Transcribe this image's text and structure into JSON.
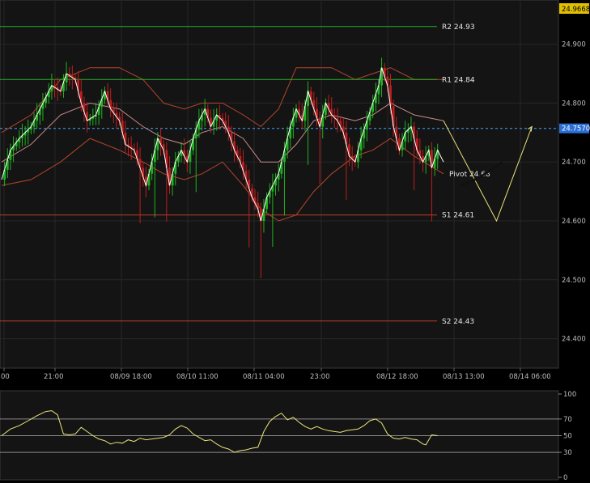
{
  "chart_data": [
    {
      "type": "candlestick",
      "ylim": [
        24.35,
        24.975
      ],
      "y_ticks": [
        24.4,
        24.5,
        24.6,
        24.7,
        24.8,
        24.9
      ],
      "y_tick_labels": [
        "24.400",
        "24.500",
        "24.600",
        "24.700",
        "24.800",
        "24.900"
      ],
      "x_tick_labels": [
        "00",
        "21:00",
        "08/09 18:00",
        "08/10 11:00",
        "08/11 04:00",
        "23:00",
        "08/12 18:00",
        "08/13 13:00",
        "08/14 06:00"
      ],
      "top_price_tag": "24.9668",
      "current_price": 24.757,
      "current_price_label": "24.7570",
      "levels": [
        {
          "name": "R2",
          "value": 24.93,
          "label": "R2 24.93",
          "color": "#27b12a"
        },
        {
          "name": "R1",
          "value": 24.84,
          "label": "R1 24.84",
          "color": "#27b12a"
        },
        {
          "name": "Pivot",
          "value": 24.68,
          "label": "Pivot 24.68",
          "color": "#cfcfcf"
        },
        {
          "name": "S1",
          "value": 24.61,
          "label": "S1 24.61",
          "color": "#c0392b"
        },
        {
          "name": "S2",
          "value": 24.43,
          "label": "S2 24.43",
          "color": "#c0392b"
        }
      ],
      "close_path": [
        [
          0,
          24.67
        ],
        [
          3,
          24.72
        ],
        [
          6,
          24.74
        ],
        [
          10,
          24.76
        ],
        [
          14,
          24.8
        ],
        [
          17,
          24.83
        ],
        [
          20,
          24.82
        ],
        [
          22,
          24.85
        ],
        [
          25,
          24.84
        ],
        [
          27,
          24.8
        ],
        [
          29,
          24.77
        ],
        [
          32,
          24.78
        ],
        [
          35,
          24.82
        ],
        [
          37,
          24.79
        ],
        [
          40,
          24.77
        ],
        [
          42,
          24.73
        ],
        [
          45,
          24.72
        ],
        [
          47,
          24.69
        ],
        [
          49,
          24.66
        ],
        [
          51,
          24.7
        ],
        [
          53,
          24.74
        ],
        [
          55,
          24.72
        ],
        [
          57,
          24.66
        ],
        [
          59,
          24.7
        ],
        [
          61,
          24.72
        ],
        [
          63,
          24.7
        ],
        [
          65,
          24.74
        ],
        [
          67,
          24.77
        ],
        [
          69,
          24.79
        ],
        [
          71,
          24.76
        ],
        [
          73,
          24.78
        ],
        [
          75,
          24.77
        ],
        [
          77,
          24.75
        ],
        [
          79,
          24.72
        ],
        [
          81,
          24.7
        ],
        [
          83,
          24.67
        ],
        [
          85,
          24.64
        ],
        [
          87,
          24.62
        ],
        [
          88,
          24.6
        ],
        [
          90,
          24.64
        ],
        [
          92,
          24.66
        ],
        [
          94,
          24.68
        ],
        [
          96,
          24.72
        ],
        [
          98,
          24.76
        ],
        [
          100,
          24.79
        ],
        [
          102,
          24.77
        ],
        [
          104,
          24.82
        ],
        [
          106,
          24.79
        ],
        [
          108,
          24.76
        ],
        [
          110,
          24.8
        ],
        [
          112,
          24.78
        ],
        [
          114,
          24.77
        ],
        [
          116,
          24.75
        ],
        [
          118,
          24.71
        ],
        [
          120,
          24.7
        ],
        [
          122,
          24.74
        ],
        [
          124,
          24.77
        ],
        [
          126,
          24.8
        ],
        [
          128,
          24.83
        ],
        [
          129,
          24.86
        ],
        [
          131,
          24.83
        ],
        [
          133,
          24.76
        ],
        [
          135,
          24.72
        ],
        [
          137,
          24.75
        ],
        [
          139,
          24.76
        ],
        [
          141,
          24.72
        ],
        [
          143,
          24.7
        ],
        [
          145,
          24.72
        ],
        [
          146,
          24.69
        ],
        [
          148,
          24.72
        ],
        [
          150,
          24.7
        ]
      ],
      "bands": {
        "upper": [
          [
            0,
            24.75
          ],
          [
            10,
            24.78
          ],
          [
            20,
            24.84
          ],
          [
            30,
            24.86
          ],
          [
            40,
            24.86
          ],
          [
            48,
            24.84
          ],
          [
            55,
            24.8
          ],
          [
            62,
            24.79
          ],
          [
            68,
            24.8
          ],
          [
            75,
            24.8
          ],
          [
            82,
            24.78
          ],
          [
            88,
            24.76
          ],
          [
            94,
            24.79
          ],
          [
            100,
            24.86
          ],
          [
            106,
            24.86
          ],
          [
            112,
            24.86
          ],
          [
            120,
            24.84
          ],
          [
            126,
            24.85
          ],
          [
            132,
            24.86
          ],
          [
            140,
            24.84
          ],
          [
            150,
            24.84
          ]
        ],
        "middle": [
          [
            0,
            24.7
          ],
          [
            10,
            24.73
          ],
          [
            20,
            24.78
          ],
          [
            30,
            24.8
          ],
          [
            40,
            24.79
          ],
          [
            48,
            24.76
          ],
          [
            55,
            24.74
          ],
          [
            62,
            24.73
          ],
          [
            68,
            24.75
          ],
          [
            75,
            24.76
          ],
          [
            82,
            24.74
          ],
          [
            88,
            24.7
          ],
          [
            94,
            24.7
          ],
          [
            100,
            24.73
          ],
          [
            106,
            24.77
          ],
          [
            112,
            24.78
          ],
          [
            120,
            24.77
          ],
          [
            126,
            24.78
          ],
          [
            132,
            24.8
          ],
          [
            140,
            24.78
          ],
          [
            150,
            24.77
          ]
        ],
        "lower": [
          [
            0,
            24.66
          ],
          [
            10,
            24.67
          ],
          [
            20,
            24.7
          ],
          [
            30,
            24.74
          ],
          [
            40,
            24.72
          ],
          [
            48,
            24.7
          ],
          [
            55,
            24.68
          ],
          [
            62,
            24.67
          ],
          [
            68,
            24.68
          ],
          [
            75,
            24.7
          ],
          [
            82,
            24.66
          ],
          [
            88,
            24.62
          ],
          [
            94,
            24.6
          ],
          [
            100,
            24.61
          ],
          [
            106,
            24.65
          ],
          [
            112,
            24.68
          ],
          [
            120,
            24.71
          ],
          [
            126,
            24.72
          ],
          [
            132,
            24.74
          ],
          [
            140,
            24.71
          ],
          [
            150,
            24.68
          ]
        ]
      },
      "forecast": {
        "color": "#e8e67a",
        "points": [
          [
            150,
            24.77
          ],
          [
            168,
            24.6
          ],
          [
            180,
            24.76
          ]
        ]
      }
    },
    {
      "type": "line",
      "name": "oscillator",
      "ylim": [
        0,
        100
      ],
      "y_ticks": [
        0,
        30,
        50,
        70,
        100
      ],
      "y_tick_labels": [
        "0",
        "30",
        "50",
        "70",
        "100"
      ],
      "gridlines": [
        30,
        50,
        70
      ],
      "color": "#e8e67a",
      "values": [
        [
          0,
          50
        ],
        [
          3,
          58
        ],
        [
          6,
          62
        ],
        [
          9,
          68
        ],
        [
          12,
          74
        ],
        [
          15,
          79
        ],
        [
          17,
          80
        ],
        [
          19,
          75
        ],
        [
          21,
          52
        ],
        [
          23,
          51
        ],
        [
          25,
          52
        ],
        [
          27,
          60
        ],
        [
          29,
          55
        ],
        [
          31,
          50
        ],
        [
          33,
          46
        ],
        [
          35,
          44
        ],
        [
          37,
          40
        ],
        [
          39,
          42
        ],
        [
          41,
          41
        ],
        [
          43,
          45
        ],
        [
          45,
          43
        ],
        [
          47,
          47
        ],
        [
          49,
          45
        ],
        [
          51,
          46
        ],
        [
          53,
          47
        ],
        [
          55,
          48
        ],
        [
          57,
          51
        ],
        [
          59,
          58
        ],
        [
          61,
          62
        ],
        [
          63,
          59
        ],
        [
          65,
          52
        ],
        [
          67,
          48
        ],
        [
          69,
          44
        ],
        [
          71,
          45
        ],
        [
          73,
          40
        ],
        [
          75,
          36
        ],
        [
          77,
          34
        ],
        [
          79,
          30
        ],
        [
          81,
          32
        ],
        [
          83,
          33
        ],
        [
          85,
          35
        ],
        [
          87,
          36
        ],
        [
          89,
          55
        ],
        [
          91,
          67
        ],
        [
          93,
          73
        ],
        [
          95,
          77
        ],
        [
          97,
          69
        ],
        [
          99,
          72
        ],
        [
          101,
          66
        ],
        [
          103,
          61
        ],
        [
          105,
          58
        ],
        [
          107,
          61
        ],
        [
          109,
          58
        ],
        [
          111,
          56
        ],
        [
          113,
          55
        ],
        [
          115,
          54
        ],
        [
          117,
          56
        ],
        [
          119,
          57
        ],
        [
          121,
          58
        ],
        [
          123,
          62
        ],
        [
          125,
          68
        ],
        [
          127,
          70
        ],
        [
          129,
          65
        ],
        [
          131,
          52
        ],
        [
          133,
          47
        ],
        [
          135,
          46
        ],
        [
          137,
          48
        ],
        [
          139,
          46
        ],
        [
          141,
          45
        ],
        [
          143,
          40
        ],
        [
          144,
          39
        ],
        [
          146,
          51
        ],
        [
          148,
          50
        ]
      ]
    }
  ]
}
